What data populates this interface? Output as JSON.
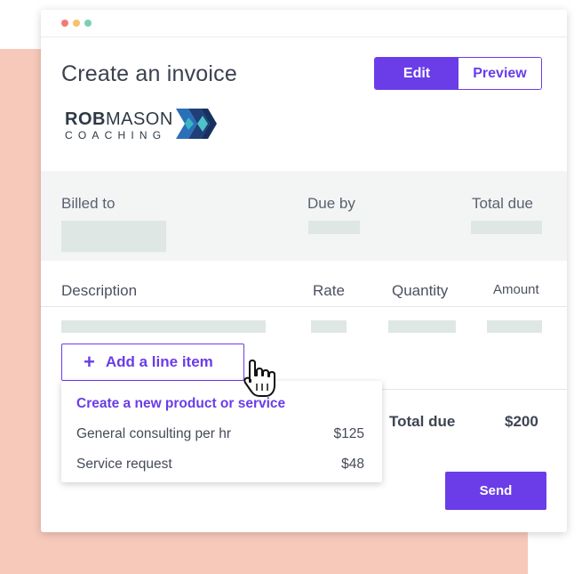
{
  "window": {
    "dots": [
      "red",
      "yellow",
      "green"
    ]
  },
  "header": {
    "title": "Create an invoice",
    "edit_label": "Edit",
    "preview_label": "Preview"
  },
  "logo": {
    "name_bold": "ROB",
    "name_rest": "MASON",
    "subtitle": "COACHING"
  },
  "billing": {
    "billed_to_label": "Billed to",
    "due_by_label": "Due by",
    "total_due_label": "Total due"
  },
  "table": {
    "columns": [
      "Description",
      "Rate",
      "Quantity",
      "Amount"
    ]
  },
  "add_line_item": {
    "label": "Add a line item"
  },
  "dropdown": {
    "create_label": "Create a new product or service",
    "items": [
      {
        "name": "General consulting per hr",
        "price": "$125"
      },
      {
        "name": "Service request",
        "price": "$48"
      }
    ]
  },
  "totals": {
    "label": "Total due",
    "value": "$200"
  },
  "send_label": "Send",
  "colors": {
    "accent": "#6a3de8",
    "background_block": "#f7c9bb",
    "placeholder": "#dfe7e5",
    "band": "#f2f5f4"
  }
}
